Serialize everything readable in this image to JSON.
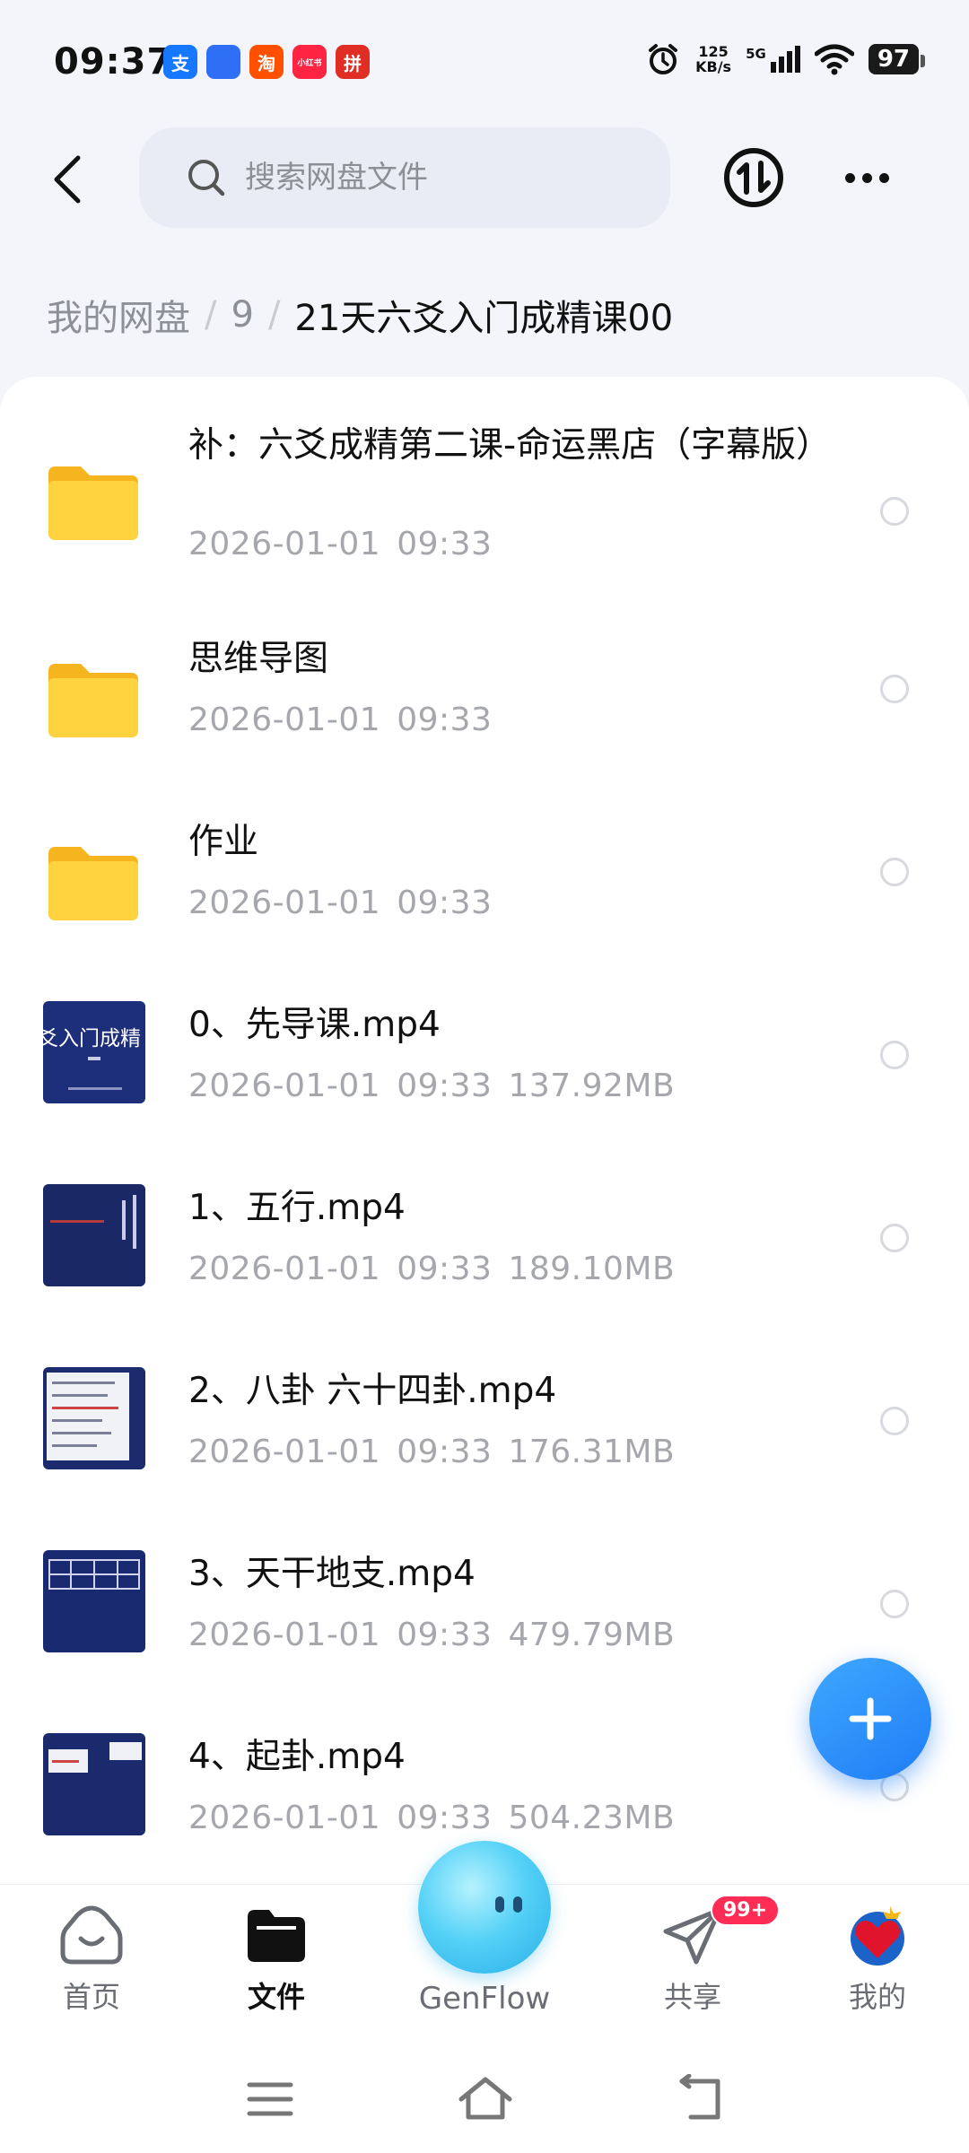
{
  "status_bar": {
    "time": "09:37",
    "apps": [
      {
        "icon": "alipay-icon",
        "text": "支",
        "color": "#1677ff"
      },
      {
        "icon": "baidu-icon",
        "text": "",
        "color": "#2f6ff5"
      },
      {
        "icon": "taobao-icon",
        "text": "淘",
        "color": "#ff5000"
      },
      {
        "icon": "xiaohongshu-icon",
        "text": "小红书",
        "color": "#ff2442"
      },
      {
        "icon": "pinduoduo-icon",
        "text": "拼",
        "color": "#e02e24"
      }
    ],
    "net_speed_value": "125",
    "net_speed_unit": "KB/s",
    "signal": "5G",
    "battery": "97"
  },
  "top_bar": {
    "search_placeholder": "搜索网盘文件"
  },
  "breadcrumb": {
    "items": [
      "我的网盘",
      "9"
    ],
    "current": "21天六爻入门成精课00"
  },
  "files": [
    {
      "name": "补：六爻成精第二课-命运黑店（字幕版）",
      "date": "2026-01-01",
      "time": "09:33",
      "size": "",
      "type": "folder"
    },
    {
      "name": "思维导图",
      "date": "2026-01-01",
      "time": "09:33",
      "size": "",
      "type": "folder"
    },
    {
      "name": "作业",
      "date": "2026-01-01",
      "time": "09:33",
      "size": "",
      "type": "folder"
    },
    {
      "name": "0、先导课.mp4",
      "date": "2026-01-01",
      "time": "09:33",
      "size": "137.92MB",
      "type": "video",
      "thumb_text": "爻入门成精"
    },
    {
      "name": "1、五行.mp4",
      "date": "2026-01-01",
      "time": "09:33",
      "size": "189.10MB",
      "type": "video"
    },
    {
      "name": "2、八卦 六十四卦.mp4",
      "date": "2026-01-01",
      "time": "09:33",
      "size": "176.31MB",
      "type": "video"
    },
    {
      "name": "3、天干地支.mp4",
      "date": "2026-01-01",
      "time": "09:33",
      "size": "479.79MB",
      "type": "video"
    },
    {
      "name": "4、起卦.mp4",
      "date": "2026-01-01",
      "time": "09:33",
      "size": "504.23MB",
      "type": "video"
    }
  ],
  "bottom_nav": {
    "home": "首页",
    "files": "文件",
    "genflow": "GenFlow",
    "share": "共享",
    "share_badge": "99+",
    "mine": "我的"
  },
  "colors": {
    "accent": "#1f7df5",
    "folder": "#ffd23f",
    "video_thumb": "#1b2a6b",
    "badge": "#ff2d55"
  }
}
